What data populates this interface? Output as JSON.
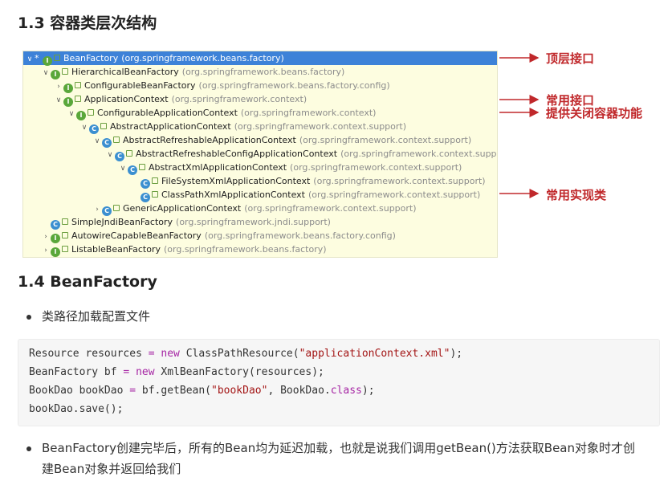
{
  "heading_1": "1.3 容器类层次结构",
  "heading_2": "1.4 BeanFactory",
  "tree": [
    {
      "name": "BeanFactory",
      "pkg": "(org.springframework.beans.factory)",
      "arrow": "⌄",
      "type": "i",
      "star": true,
      "selected": true
    },
    {
      "name": "HierarchicalBeanFactory",
      "pkg": "(org.springframework.beans.factory)",
      "arrow": "⌄",
      "type": "i"
    },
    {
      "name": "ConfigurableBeanFactory",
      "pkg": "(org.springframework.beans.factory.config)",
      "arrow": "›",
      "type": "i"
    },
    {
      "name": "ApplicationContext",
      "pkg": "(org.springframework.context)",
      "arrow": "⌄",
      "type": "i"
    },
    {
      "name": "ConfigurableApplicationContext",
      "pkg": "(org.springframework.context)",
      "arrow": "⌄",
      "type": "i"
    },
    {
      "name": "AbstractApplicationContext",
      "pkg": "(org.springframework.context.support)",
      "arrow": "⌄",
      "type": "c"
    },
    {
      "name": "AbstractRefreshableApplicationContext",
      "pkg": "(org.springframework.context.support)",
      "arrow": "⌄",
      "type": "c"
    },
    {
      "name": "AbstractRefreshableConfigApplicationContext",
      "pkg": "(org.springframework.context.support)",
      "arrow": "⌄",
      "type": "c"
    },
    {
      "name": "AbstractXmlApplicationContext",
      "pkg": "(org.springframework.context.support)",
      "arrow": "⌄",
      "type": "c"
    },
    {
      "name": "FileSystemXmlApplicationContext",
      "pkg": "(org.springframework.context.support)",
      "arrow": "",
      "type": "c"
    },
    {
      "name": "ClassPathXmlApplicationContext",
      "pkg": "(org.springframework.context.support)",
      "arrow": "",
      "type": "c"
    },
    {
      "name": "GenericApplicationContext",
      "pkg": "(org.springframework.context.support)",
      "arrow": "›",
      "type": "c"
    },
    {
      "name": "SimpleJndiBeanFactory",
      "pkg": "(org.springframework.jndi.support)",
      "arrow": "",
      "type": "c"
    },
    {
      "name": "AutowireCapableBeanFactory",
      "pkg": "(org.springframework.beans.factory.config)",
      "arrow": "›",
      "type": "i"
    },
    {
      "name": "ListableBeanFactory",
      "pkg": "(org.springframework.beans.factory)",
      "arrow": "›",
      "type": "i"
    }
  ],
  "annotations": {
    "top": "顶层接口",
    "common_iface": "常用接口",
    "close": "提供关闭容器功能",
    "common_impl": "常用实现类"
  },
  "bullet_1": "类路径加载配置文件",
  "code": {
    "line1": {
      "type": "Resource",
      "var": "resources",
      "eq": "=",
      "kw": "new",
      "cls": "ClassPathResource(",
      "str": "\"applicationContext.xml\"",
      "end": ");"
    },
    "line2": {
      "type": "BeanFactory",
      "var": "bf",
      "eq": "=",
      "kw": "new",
      "rest": "XmlBeanFactory(resources);"
    },
    "line3": {
      "type": "BookDao",
      "var": "bookDao",
      "eq": "=",
      "call": "bf.getBean(",
      "str": "\"bookDao\"",
      "mid": ", BookDao.",
      "kw": "class",
      "end": ");"
    },
    "line4": "bookDao.save();"
  },
  "bullet_2_line1": "BeanFactory创建完毕后，所有的Bean均为延迟加载，也就是说我们调用getBean()方法获取Bean对象时才创",
  "bullet_2_line2": "建Bean对象并返回给我们",
  "colors": {
    "annotation": "#c0282b",
    "selection": "#3d82d8",
    "tree_bg": "#fdfde0"
  }
}
